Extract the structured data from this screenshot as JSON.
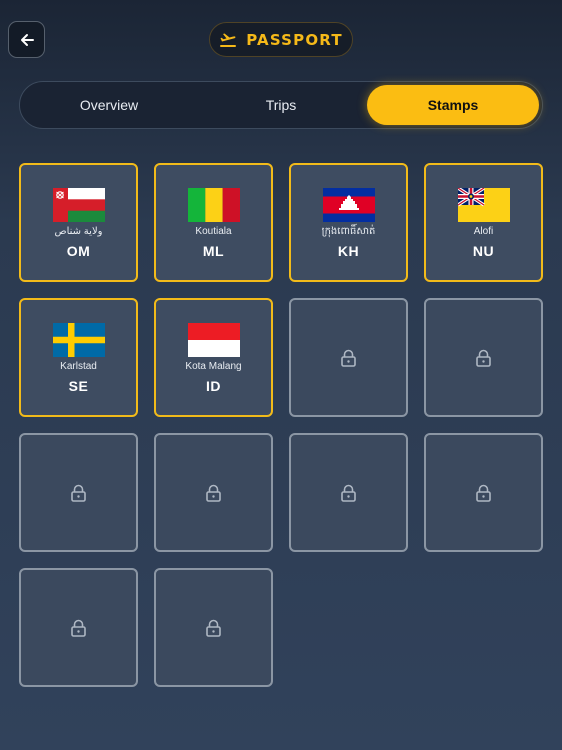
{
  "header": {
    "back_icon": "arrow-left-icon",
    "title": "PASSPORT",
    "title_icon": "airplane-departure-icon",
    "accent_color": "#f5b919"
  },
  "tabs": [
    {
      "label": "Overview",
      "active": false
    },
    {
      "label": "Trips",
      "active": false
    },
    {
      "label": "Stamps",
      "active": true
    }
  ],
  "stamps": [
    {
      "city": "ولاية شناص",
      "code": "OM",
      "flag": "oman-flag"
    },
    {
      "city": "Koutiala",
      "code": "ML",
      "flag": "mali-flag"
    },
    {
      "city": "ក្រុងពោធិ៍សាត់",
      "code": "KH",
      "flag": "cambodia-flag"
    },
    {
      "city": "Alofi",
      "code": "NU",
      "flag": "niue-flag"
    },
    {
      "city": "Karlstad",
      "code": "SE",
      "flag": "sweden-flag"
    },
    {
      "city": "Kota Malang",
      "code": "ID",
      "flag": "indonesia-flag"
    }
  ],
  "locked_slots": 8,
  "lock_icon": "lock-icon"
}
